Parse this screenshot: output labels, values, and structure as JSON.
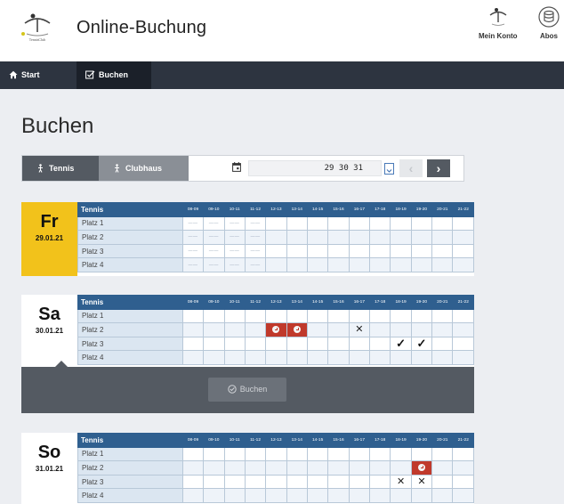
{
  "app": {
    "title": "Online-Buchung",
    "logo_text": "TennisClub"
  },
  "header_actions": [
    {
      "label": "Mein Konto",
      "icon": "tennis-logo-icon"
    },
    {
      "label": "Abos",
      "icon": "database-icon"
    }
  ],
  "nav": [
    {
      "label": "Start",
      "icon": "home-icon"
    },
    {
      "label": "Buchen",
      "icon": "checkbox-edit-icon"
    }
  ],
  "page": {
    "title": "Buchen"
  },
  "filter": {
    "sports": [
      "Tennis",
      "Clubhaus"
    ],
    "date_value": "29 30 31",
    "prev": "‹",
    "next": "›"
  },
  "colors": {
    "nav_bg": "#2d3440",
    "grid_header": "#2f5f8f",
    "today": "#f2c21b",
    "booked": "#c0392b"
  },
  "grid": {
    "header_label": "Tennis",
    "slots": [
      "08-09",
      "09-10",
      "10-11",
      "11-12",
      "12-13",
      "13-14",
      "14-15",
      "15-16",
      "16-17",
      "17-18",
      "18-19",
      "19-20",
      "20-21",
      "21-22"
    ],
    "courts": [
      "Platz 1",
      "Platz 2",
      "Platz 3",
      "Platz 4"
    ]
  },
  "days": [
    {
      "day": "Fr",
      "date": "29.01.21",
      "highlight": true,
      "rows": [
        [
          "b",
          "b",
          "b",
          "b",
          "",
          "",
          "",
          "",
          "",
          "",
          "",
          "",
          "",
          ""
        ],
        [
          "b",
          "b",
          "b",
          "b",
          "",
          "",
          "",
          "",
          "",
          "",
          "",
          "",
          "",
          ""
        ],
        [
          "b",
          "b",
          "b",
          "b",
          "",
          "",
          "",
          "",
          "",
          "",
          "",
          "",
          "",
          ""
        ],
        [
          "b",
          "b",
          "b",
          "b",
          "",
          "",
          "",
          "",
          "",
          "",
          "",
          "",
          "",
          ""
        ]
      ]
    },
    {
      "day": "Sa",
      "date": "30.01.21",
      "highlight": false,
      "rows": [
        [
          "",
          "",
          "",
          "",
          "",
          "",
          "",
          "",
          "",
          "",
          "",
          "",
          "",
          ""
        ],
        [
          "",
          "",
          "",
          "",
          "r",
          "r",
          "",
          "",
          "x",
          "",
          "",
          "",
          "",
          ""
        ],
        [
          "",
          "",
          "",
          "",
          "",
          "",
          "",
          "",
          "",
          "",
          "c",
          "c",
          "",
          ""
        ],
        [
          "",
          "",
          "",
          "",
          "",
          "",
          "",
          "",
          "",
          "",
          "",
          "",
          "",
          ""
        ]
      ]
    },
    {
      "day": "So",
      "date": "31.01.21",
      "highlight": false,
      "rows": [
        [
          "",
          "",
          "",
          "",
          "",
          "",
          "",
          "",
          "",
          "",
          "",
          "",
          "",
          ""
        ],
        [
          "",
          "",
          "",
          "",
          "",
          "",
          "",
          "",
          "",
          "",
          "",
          "r",
          "",
          ""
        ],
        [
          "",
          "",
          "",
          "",
          "",
          "",
          "",
          "",
          "",
          "",
          "x",
          "x",
          "",
          ""
        ],
        [
          "",
          "",
          "",
          "",
          "",
          "",
          "",
          "",
          "",
          "",
          "",
          "",
          "",
          ""
        ]
      ]
    }
  ],
  "booking": {
    "button_label": "Buchen"
  }
}
